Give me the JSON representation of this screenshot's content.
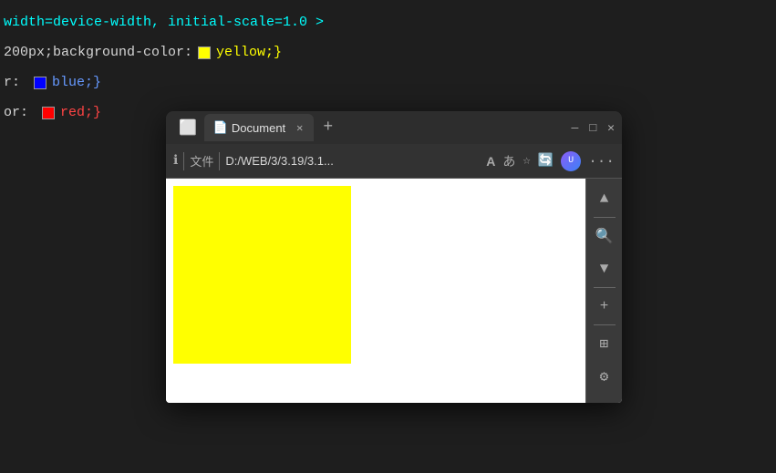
{
  "editor": {
    "background": "#1e1e1e",
    "lines": [
      {
        "id": "line1",
        "content": "width=device-width, initial-scale=1.0 >",
        "color": "cyan"
      },
      {
        "id": "line2",
        "prefix": "",
        "prop": "200px;background-color:",
        "swatch": "yellow",
        "swatchColor": "#ffff00",
        "value": "yellow;}",
        "valueColor": "yellow-text"
      },
      {
        "id": "line3",
        "prefix": "r:",
        "swatch": "blue",
        "swatchColor": "#0000ff",
        "value": "blue;}",
        "valueColor": "blue-text"
      },
      {
        "id": "line4",
        "prefix": "or:",
        "swatch": "red",
        "swatchColor": "#ff0000",
        "value": "red;}",
        "valueColor": "red-text"
      }
    ]
  },
  "browser": {
    "tab": {
      "title": "Document",
      "favicon": "📄"
    },
    "toolbar": {
      "info_icon": "ℹ",
      "label_file": "文件",
      "url": "D:/WEB/3/3.19/3.1...",
      "btn_read": "A",
      "btn_immersive": "あ",
      "btn_star": "☆",
      "btn_refresh": "↻"
    },
    "sidebar_buttons": [
      "▲",
      "🔍",
      "▼",
      "+",
      "⊞",
      "⚙"
    ],
    "controls": {
      "minimize": "—",
      "maximize": "□",
      "close": "✕"
    }
  }
}
